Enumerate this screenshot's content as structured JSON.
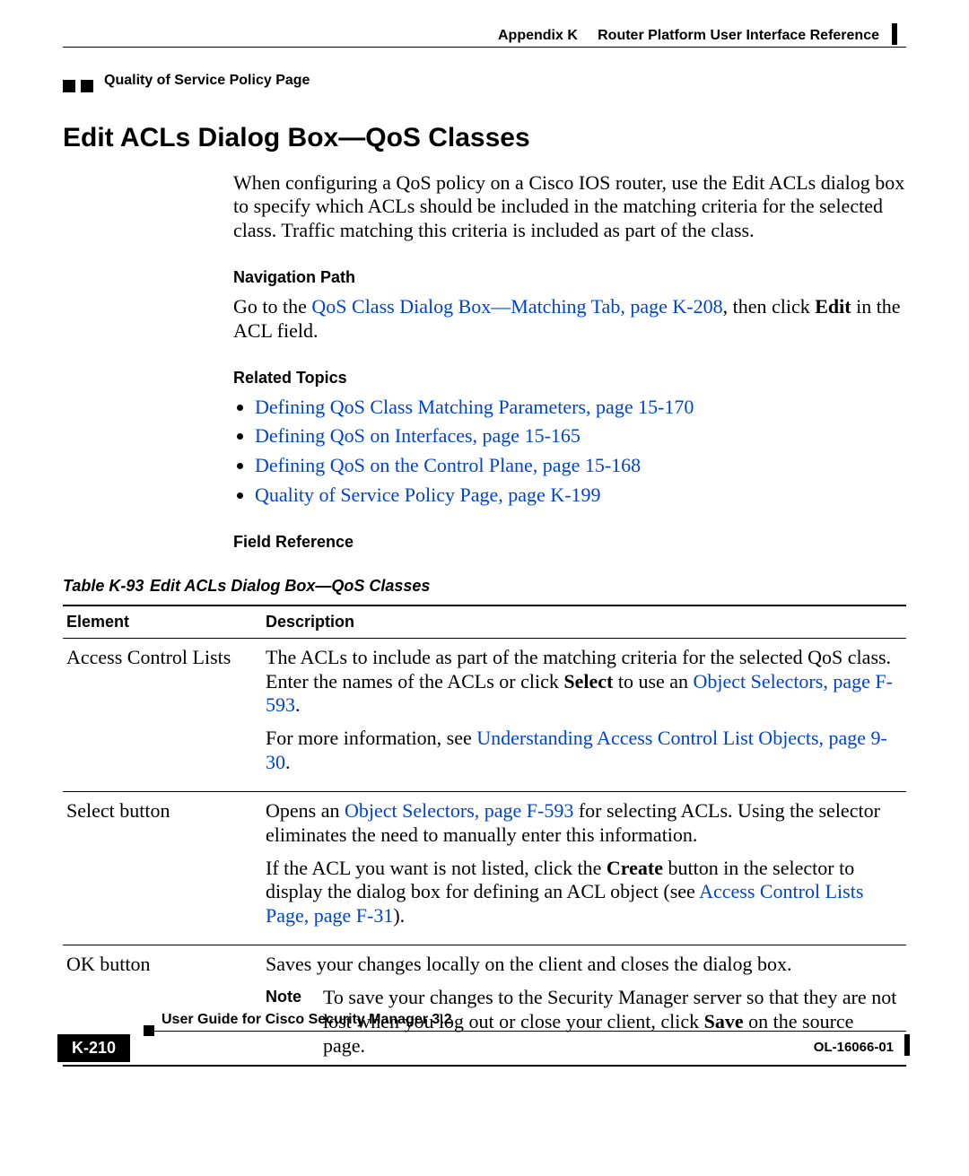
{
  "header": {
    "appendix": "Appendix K",
    "appendix_title": "Router Platform User Interface Reference",
    "section": "Quality of Service Policy Page"
  },
  "title": "Edit ACLs Dialog Box—QoS Classes",
  "intro": "When configuring a QoS policy on a Cisco IOS router, use the Edit ACLs dialog box to specify which ACLs should be included in the matching criteria for the selected class. Traffic matching this criteria is included as part of the class.",
  "nav_path": {
    "heading": "Navigation Path",
    "pre": "Go to the ",
    "link": "QoS Class Dialog Box—Matching Tab, page K-208",
    "post1": ", then click ",
    "bold": "Edit",
    "post2": " in the ACL field."
  },
  "related": {
    "heading": "Related Topics",
    "items": [
      "Defining QoS Class Matching Parameters, page 15-170",
      "Defining QoS on Interfaces, page 15-165",
      "Defining QoS on the Control Plane, page 15-168",
      "Quality of Service Policy Page, page K-199"
    ]
  },
  "field_ref": {
    "heading": "Field Reference",
    "table_num": "Table K-93",
    "table_title": "Edit ACLs Dialog Box—QoS Classes",
    "cols": {
      "element": "Element",
      "description": "Description"
    },
    "rows": {
      "acl": {
        "element": "Access Control Lists",
        "p1a": "The ACLs to include as part of the matching criteria for the selected QoS class. Enter the names of the ACLs or click ",
        "p1bold": "Select",
        "p1b": " to use an ",
        "p1link": "Object Selectors, page F-593",
        "p1c": ".",
        "p2a": "For more information, see ",
        "p2link": "Understanding Access Control List Objects, page 9-30",
        "p2b": "."
      },
      "select": {
        "element": "Select button",
        "p1a": "Opens an ",
        "p1link": "Object Selectors, page F-593",
        "p1b": " for selecting ACLs. Using the selector eliminates the need to manually enter this information.",
        "p2a": "If the ACL you want is not listed, click the ",
        "p2bold": "Create",
        "p2b": " button in the selector to display the dialog box for defining an ACL object (see ",
        "p2link": "Access Control Lists Page, page F-31",
        "p2c": ")."
      },
      "ok": {
        "element": "OK button",
        "p1": "Saves your changes locally on the client and closes the dialog box.",
        "note_label": "Note",
        "note_a": "To save your changes to the Security Manager server so that they are not lost when you log out or close your client, click ",
        "note_bold": "Save",
        "note_b": " on the source page."
      }
    }
  },
  "footer": {
    "guide": "User Guide for Cisco Security Manager 3.2",
    "page": "K-210",
    "doc": "OL-16066-01"
  }
}
